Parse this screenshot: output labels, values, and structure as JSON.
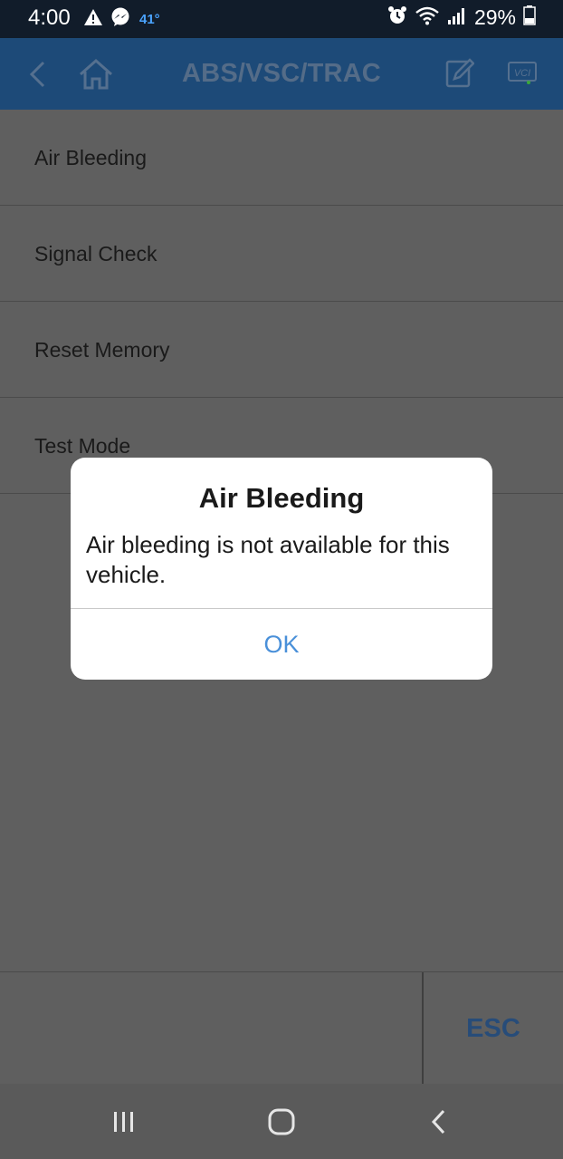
{
  "status_bar": {
    "time": "4:00",
    "temperature": "41°",
    "battery": "29%",
    "left_icons": [
      "warning-icon",
      "messenger-icon"
    ],
    "right_icons": [
      "alarm-icon",
      "wifi-icon",
      "signal-icon",
      "battery-icon"
    ]
  },
  "header": {
    "title": "ABS/VSC/TRAC",
    "background": "#1d4a78",
    "vci_label": "VCI",
    "icons": [
      "back-icon",
      "home-icon",
      "edit-icon",
      "vci-icon"
    ]
  },
  "menu": {
    "items": [
      {
        "label": "Air Bleeding"
      },
      {
        "label": "Signal Check"
      },
      {
        "label": "Reset Memory"
      },
      {
        "label": "Test Mode"
      }
    ]
  },
  "footer": {
    "esc_label": "ESC"
  },
  "dialog": {
    "title": "Air Bleeding",
    "message": "Air bleeding is not available for this vehicle.",
    "ok_label": "OK",
    "accent": "#4a90d9"
  },
  "nav_bar": {
    "icons": [
      "recent-apps-icon",
      "home-button-icon",
      "back-nav-icon"
    ]
  }
}
